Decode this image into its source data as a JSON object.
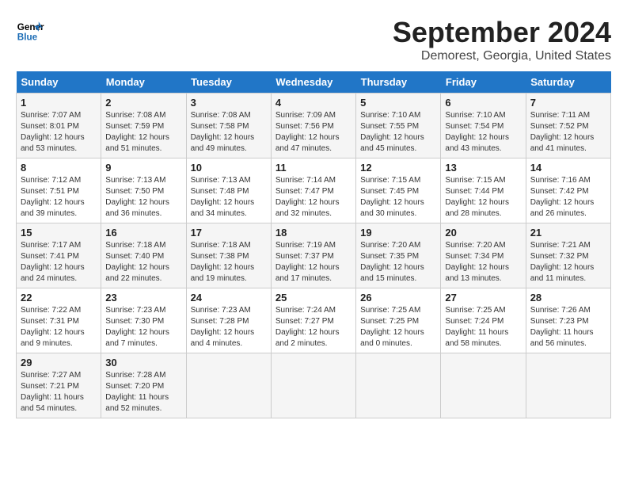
{
  "header": {
    "logo_line1": "General",
    "logo_line2": "Blue",
    "month": "September 2024",
    "location": "Demorest, Georgia, United States"
  },
  "weekdays": [
    "Sunday",
    "Monday",
    "Tuesday",
    "Wednesday",
    "Thursday",
    "Friday",
    "Saturday"
  ],
  "weeks": [
    [
      {
        "day": "1",
        "sunrise": "7:07 AM",
        "sunset": "8:01 PM",
        "daylight": "12 hours and 53 minutes."
      },
      {
        "day": "2",
        "sunrise": "7:08 AM",
        "sunset": "7:59 PM",
        "daylight": "12 hours and 51 minutes."
      },
      {
        "day": "3",
        "sunrise": "7:08 AM",
        "sunset": "7:58 PM",
        "daylight": "12 hours and 49 minutes."
      },
      {
        "day": "4",
        "sunrise": "7:09 AM",
        "sunset": "7:56 PM",
        "daylight": "12 hours and 47 minutes."
      },
      {
        "day": "5",
        "sunrise": "7:10 AM",
        "sunset": "7:55 PM",
        "daylight": "12 hours and 45 minutes."
      },
      {
        "day": "6",
        "sunrise": "7:10 AM",
        "sunset": "7:54 PM",
        "daylight": "12 hours and 43 minutes."
      },
      {
        "day": "7",
        "sunrise": "7:11 AM",
        "sunset": "7:52 PM",
        "daylight": "12 hours and 41 minutes."
      }
    ],
    [
      {
        "day": "8",
        "sunrise": "7:12 AM",
        "sunset": "7:51 PM",
        "daylight": "12 hours and 39 minutes."
      },
      {
        "day": "9",
        "sunrise": "7:13 AM",
        "sunset": "7:50 PM",
        "daylight": "12 hours and 36 minutes."
      },
      {
        "day": "10",
        "sunrise": "7:13 AM",
        "sunset": "7:48 PM",
        "daylight": "12 hours and 34 minutes."
      },
      {
        "day": "11",
        "sunrise": "7:14 AM",
        "sunset": "7:47 PM",
        "daylight": "12 hours and 32 minutes."
      },
      {
        "day": "12",
        "sunrise": "7:15 AM",
        "sunset": "7:45 PM",
        "daylight": "12 hours and 30 minutes."
      },
      {
        "day": "13",
        "sunrise": "7:15 AM",
        "sunset": "7:44 PM",
        "daylight": "12 hours and 28 minutes."
      },
      {
        "day": "14",
        "sunrise": "7:16 AM",
        "sunset": "7:42 PM",
        "daylight": "12 hours and 26 minutes."
      }
    ],
    [
      {
        "day": "15",
        "sunrise": "7:17 AM",
        "sunset": "7:41 PM",
        "daylight": "12 hours and 24 minutes."
      },
      {
        "day": "16",
        "sunrise": "7:18 AM",
        "sunset": "7:40 PM",
        "daylight": "12 hours and 22 minutes."
      },
      {
        "day": "17",
        "sunrise": "7:18 AM",
        "sunset": "7:38 PM",
        "daylight": "12 hours and 19 minutes."
      },
      {
        "day": "18",
        "sunrise": "7:19 AM",
        "sunset": "7:37 PM",
        "daylight": "12 hours and 17 minutes."
      },
      {
        "day": "19",
        "sunrise": "7:20 AM",
        "sunset": "7:35 PM",
        "daylight": "12 hours and 15 minutes."
      },
      {
        "day": "20",
        "sunrise": "7:20 AM",
        "sunset": "7:34 PM",
        "daylight": "12 hours and 13 minutes."
      },
      {
        "day": "21",
        "sunrise": "7:21 AM",
        "sunset": "7:32 PM",
        "daylight": "12 hours and 11 minutes."
      }
    ],
    [
      {
        "day": "22",
        "sunrise": "7:22 AM",
        "sunset": "7:31 PM",
        "daylight": "12 hours and 9 minutes."
      },
      {
        "day": "23",
        "sunrise": "7:23 AM",
        "sunset": "7:30 PM",
        "daylight": "12 hours and 7 minutes."
      },
      {
        "day": "24",
        "sunrise": "7:23 AM",
        "sunset": "7:28 PM",
        "daylight": "12 hours and 4 minutes."
      },
      {
        "day": "25",
        "sunrise": "7:24 AM",
        "sunset": "7:27 PM",
        "daylight": "12 hours and 2 minutes."
      },
      {
        "day": "26",
        "sunrise": "7:25 AM",
        "sunset": "7:25 PM",
        "daylight": "12 hours and 0 minutes."
      },
      {
        "day": "27",
        "sunrise": "7:25 AM",
        "sunset": "7:24 PM",
        "daylight": "11 hours and 58 minutes."
      },
      {
        "day": "28",
        "sunrise": "7:26 AM",
        "sunset": "7:23 PM",
        "daylight": "11 hours and 56 minutes."
      }
    ],
    [
      {
        "day": "29",
        "sunrise": "7:27 AM",
        "sunset": "7:21 PM",
        "daylight": "11 hours and 54 minutes."
      },
      {
        "day": "30",
        "sunrise": "7:28 AM",
        "sunset": "7:20 PM",
        "daylight": "11 hours and 52 minutes."
      },
      null,
      null,
      null,
      null,
      null
    ]
  ]
}
